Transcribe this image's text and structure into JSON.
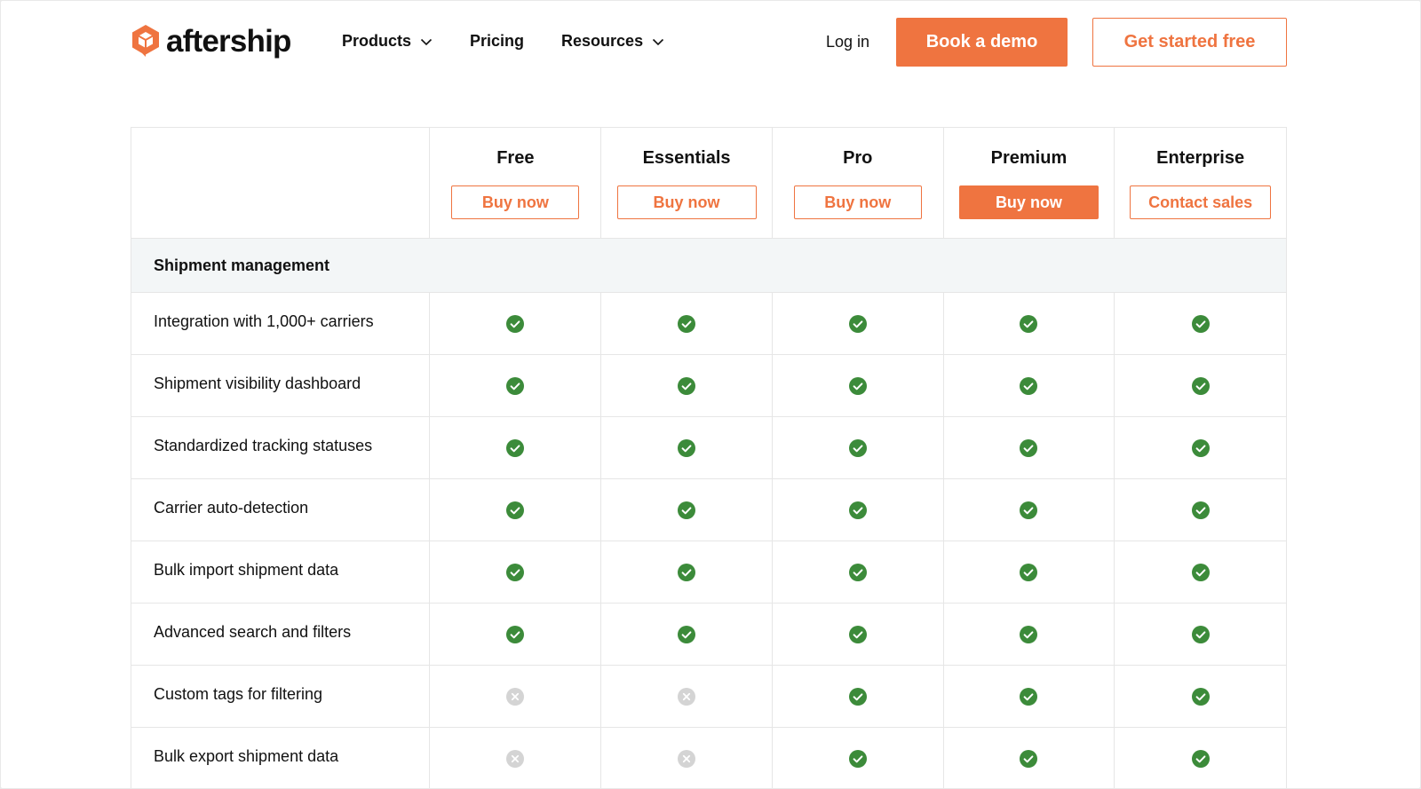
{
  "header": {
    "logo_text": "aftership",
    "nav": [
      {
        "label": "Products",
        "has_dropdown": true
      },
      {
        "label": "Pricing",
        "has_dropdown": false
      },
      {
        "label": "Resources",
        "has_dropdown": true
      }
    ],
    "login_label": "Log in",
    "demo_label": "Book a demo",
    "started_label": "Get started free"
  },
  "colors": {
    "brand_orange": "#ef7440",
    "check_green": "#3c8b3a",
    "cross_gray": "#d4d4d4",
    "section_bg": "#f3f6f7"
  },
  "plans": [
    {
      "name": "Free",
      "cta": "Buy now",
      "style": "outline"
    },
    {
      "name": "Essentials",
      "cta": "Buy now",
      "style": "outline"
    },
    {
      "name": "Pro",
      "cta": "Buy now",
      "style": "outline"
    },
    {
      "name": "Premium",
      "cta": "Buy now",
      "style": "primary"
    },
    {
      "name": "Enterprise",
      "cta": "Contact sales",
      "style": "outline"
    }
  ],
  "section": {
    "title": "Shipment management",
    "features": [
      {
        "label": "Integration with 1,000+ carriers",
        "availability": [
          true,
          true,
          true,
          true,
          true
        ]
      },
      {
        "label": "Shipment visibility dashboard",
        "availability": [
          true,
          true,
          true,
          true,
          true
        ]
      },
      {
        "label": "Standardized tracking statuses",
        "availability": [
          true,
          true,
          true,
          true,
          true
        ]
      },
      {
        "label": "Carrier auto-detection",
        "availability": [
          true,
          true,
          true,
          true,
          true
        ]
      },
      {
        "label": "Bulk import shipment data",
        "availability": [
          true,
          true,
          true,
          true,
          true
        ]
      },
      {
        "label": "Advanced search and filters",
        "availability": [
          true,
          true,
          true,
          true,
          true
        ]
      },
      {
        "label": "Custom tags for filtering",
        "availability": [
          false,
          false,
          true,
          true,
          true
        ]
      },
      {
        "label": "Bulk export shipment data",
        "availability": [
          false,
          false,
          true,
          true,
          true
        ]
      }
    ]
  }
}
